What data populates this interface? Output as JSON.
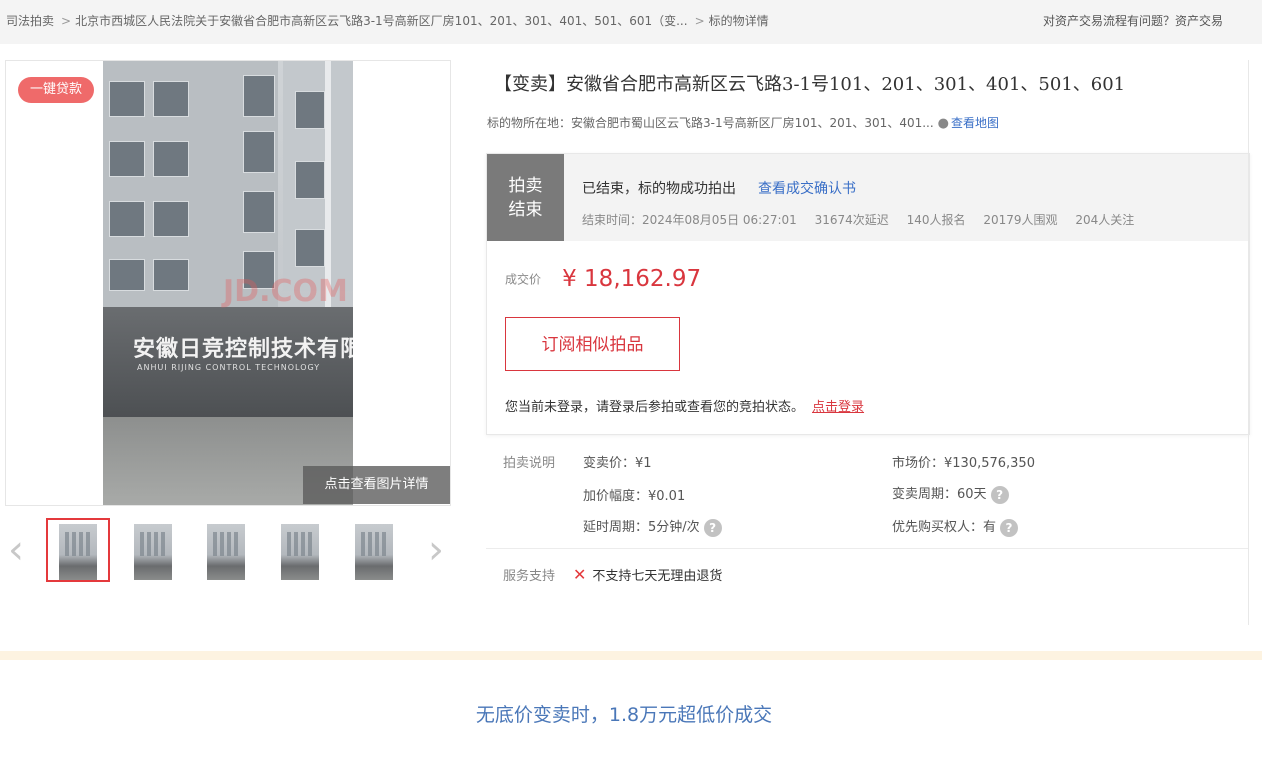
{
  "breadcrumb": {
    "items": [
      "司法拍卖",
      "北京市西城区人民法院关于安徽省合肥市高新区云飞路3-1号高新区厂房101、201、301、401、501、601（变...",
      "标的物详情"
    ],
    "separator": ">",
    "help_text": "对资产交易流程有问题？资产交易"
  },
  "gallery": {
    "badge": "一键贷款",
    "view_detail": "点击查看图片详情",
    "watermark": "JD.COM 京东",
    "sign_text": "安徽日竞控制技术有限公司",
    "sign_sub": "ANHUI RIJING CONTROL TECHNOLOGY",
    "prev_arrow": "‹",
    "next_arrow": "›",
    "thumbnail_count": 5,
    "active_thumbnail": 1
  },
  "item": {
    "title": "【变卖】安徽省合肥市高新区云飞路3-1号101、201、301、401、501、601",
    "location_label": "标的物所在地：安徽合肥市蜀山区云飞路3-1号高新区厂房101、201、301、401...",
    "map_link": "查看地图"
  },
  "status": {
    "tag_line1": "拍卖",
    "tag_line2": "结束",
    "message": "已结束，标的物成功拍出",
    "confirm_link": "查看成交确认书",
    "end_time": "结束时间：2024年08月05日 06:27:01",
    "delays": "31674次延迟",
    "signups": "140人报名",
    "watchers": "20179人围观",
    "followers": "204人关注"
  },
  "deal": {
    "label": "成交价",
    "price": "¥ 18,162.97",
    "subscribe_button": "订阅相似拍品",
    "login_tip": "您当前未登录，请登录后参拍或查看您的竞拍状态。",
    "login_link": "点击登录"
  },
  "auction_info": {
    "label": "拍卖说明",
    "start_price": "变卖价：¥1",
    "increment": "加价幅度：¥0.01",
    "delay_period": "延时周期：5分钟/次",
    "market_price": "市场价：¥130,576,350",
    "sale_period": "变卖周期：60天",
    "priority": "优先购买权人：有",
    "help_icon": "?"
  },
  "service": {
    "label": "服务支持",
    "icon": "✕",
    "text": "不支持七天无理由退货"
  },
  "caption": "无底价变卖时，1.8万元超低价成交",
  "colors": {
    "accent_red": "#d9363e",
    "link_blue": "#3a6fc7",
    "status_gray": "#7a7a7a",
    "caption_blue": "#4a77b8"
  }
}
